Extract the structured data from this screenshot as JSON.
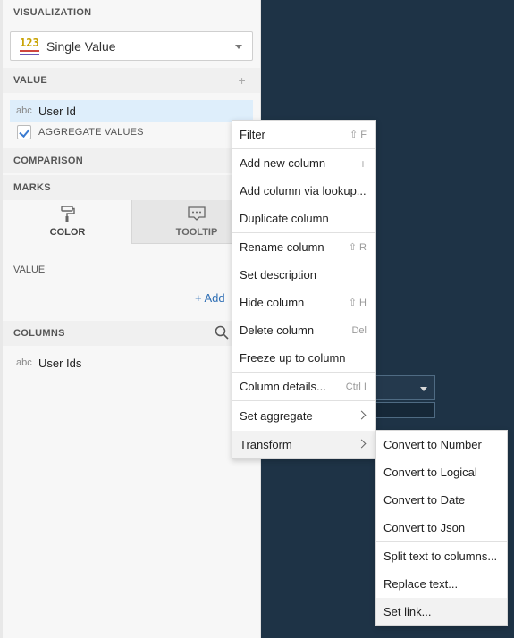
{
  "sidebar": {
    "visualization_header": "VISUALIZATION",
    "visualization_select": {
      "icon": "123",
      "label": "Single Value"
    },
    "value_header": "VALUE",
    "value_field": {
      "type": "abc",
      "name": "User Id"
    },
    "aggregate_label": "AGGREGATE VALUES",
    "aggregate_checked": true,
    "comparison_header": "COMPARISON",
    "marks_header": "MARKS",
    "tabs": [
      {
        "label": "COLOR",
        "icon": "paint-roller-icon",
        "active": true
      },
      {
        "label": "TOOLTIP",
        "icon": "tooltip-icon",
        "active": false
      }
    ],
    "marks_value_label": "VALUE",
    "add_label": "+ Add",
    "columns_header": "COLUMNS",
    "columns": [
      {
        "type": "abc",
        "name": "User Ids"
      }
    ]
  },
  "context_menu": {
    "items": [
      {
        "label": "Filter",
        "shortcut": "⇧ F"
      },
      {
        "label": "Add new column",
        "shortcut": "+"
      },
      {
        "label": "Add column via lookup...",
        "shortcut": ""
      },
      {
        "label": "Duplicate column",
        "shortcut": ""
      },
      {
        "label": "Rename column",
        "shortcut": "⇧ R"
      },
      {
        "label": "Set description",
        "shortcut": ""
      },
      {
        "label": "Hide column",
        "shortcut": "⇧ H"
      },
      {
        "label": "Delete column",
        "shortcut": "Del"
      },
      {
        "label": "Freeze up to column",
        "shortcut": ""
      },
      {
        "label": "Column details...",
        "shortcut": "Ctrl I"
      },
      {
        "label": "Set aggregate",
        "shortcut": ""
      },
      {
        "label": "Transform",
        "shortcut": ""
      }
    ]
  },
  "transform_submenu": {
    "items": [
      {
        "label": "Convert to Number"
      },
      {
        "label": "Convert to Logical"
      },
      {
        "label": "Convert to Date"
      },
      {
        "label": "Convert to Json"
      },
      {
        "label": "Split text to columns..."
      },
      {
        "label": "Replace text..."
      },
      {
        "label": "Set link..."
      }
    ]
  },
  "colors": {
    "canvas_dark": "#1e3346",
    "selected_field_bg": "#deeefb",
    "link_blue": "#2f6fb5"
  }
}
